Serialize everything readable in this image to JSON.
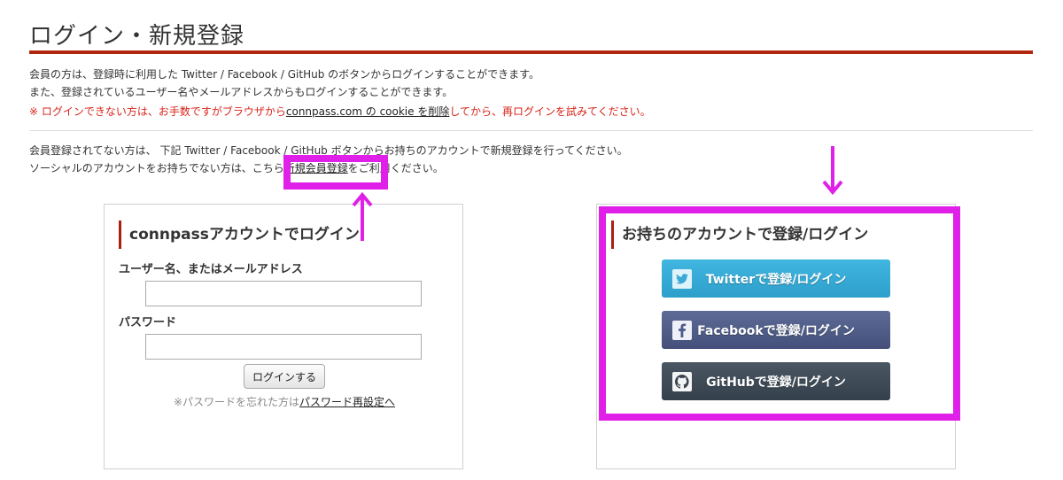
{
  "title": "ログイン・新規登録",
  "intro": {
    "line1": "会員の方は、登録時に利用した Twitter / Facebook / GitHub のボタンからログインすることができます。",
    "line2": "また、登録されているユーザー名やメールアドレスからもログインすることができます。",
    "warn_prefix": "※ ログインできない方は、お手数ですがブラウザから",
    "warn_link": "connpass.com の cookie を削除",
    "warn_suffix": "してから、再ログインを試みてください。"
  },
  "register": {
    "line1": "会員登録されてない方は、 下記 Twitter / Facebook / GitHub ボタンからお持ちのアカウントで新規登録を行ってください。",
    "line2_prefix": "ソーシャルのアカウントをお持ちでない方は、こちら",
    "line2_link": "新規会員登録",
    "line2_suffix": "をご利用ください。"
  },
  "login_panel": {
    "heading": "connpassアカウントでログイン",
    "username_label": "ユーザー名、またはメールアドレス",
    "password_label": "パスワード",
    "login_button": "ログインする",
    "forgot_prefix": "※パスワードを忘れた方は",
    "forgot_link": "パスワード再設定へ"
  },
  "social_panel": {
    "heading": "お持ちのアカウントで登録/ログイン",
    "twitter": "Twitterで登録/ログイン",
    "facebook": "Facebookで登録/ログイン",
    "github": "GitHubで登録/ログイン"
  },
  "colors": {
    "accent": "#b0260f",
    "warning": "#d8251b",
    "highlight": "#e020e8",
    "twitter": "#2d9fca",
    "facebook": "#44507a",
    "github": "#34404b"
  }
}
